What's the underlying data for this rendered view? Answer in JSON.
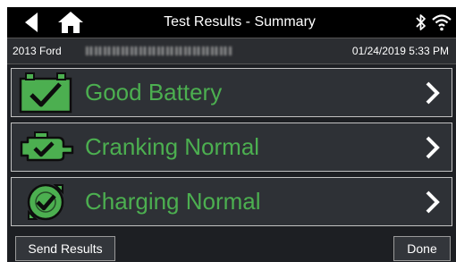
{
  "header": {
    "title": "Test Results - Summary",
    "icons": [
      "back-arrow-icon",
      "home-icon",
      "bluetooth-icon",
      "wifi-icon"
    ]
  },
  "vehicle_bar": {
    "vehicle": "2013 Ford",
    "datetime": "01/24/2019 5:33 PM"
  },
  "results": [
    {
      "label": "Good Battery",
      "icon": "battery-check-icon"
    },
    {
      "label": "Cranking Normal",
      "icon": "starter-motor-check-icon"
    },
    {
      "label": "Charging Normal",
      "icon": "alternator-check-icon"
    }
  ],
  "footer": {
    "send_label": "Send Results",
    "done_label": "Done"
  },
  "colors": {
    "accent_green": "#4caf50",
    "background": "#1d1f23",
    "row_background": "#2e3136",
    "titlebar": "#000000"
  }
}
